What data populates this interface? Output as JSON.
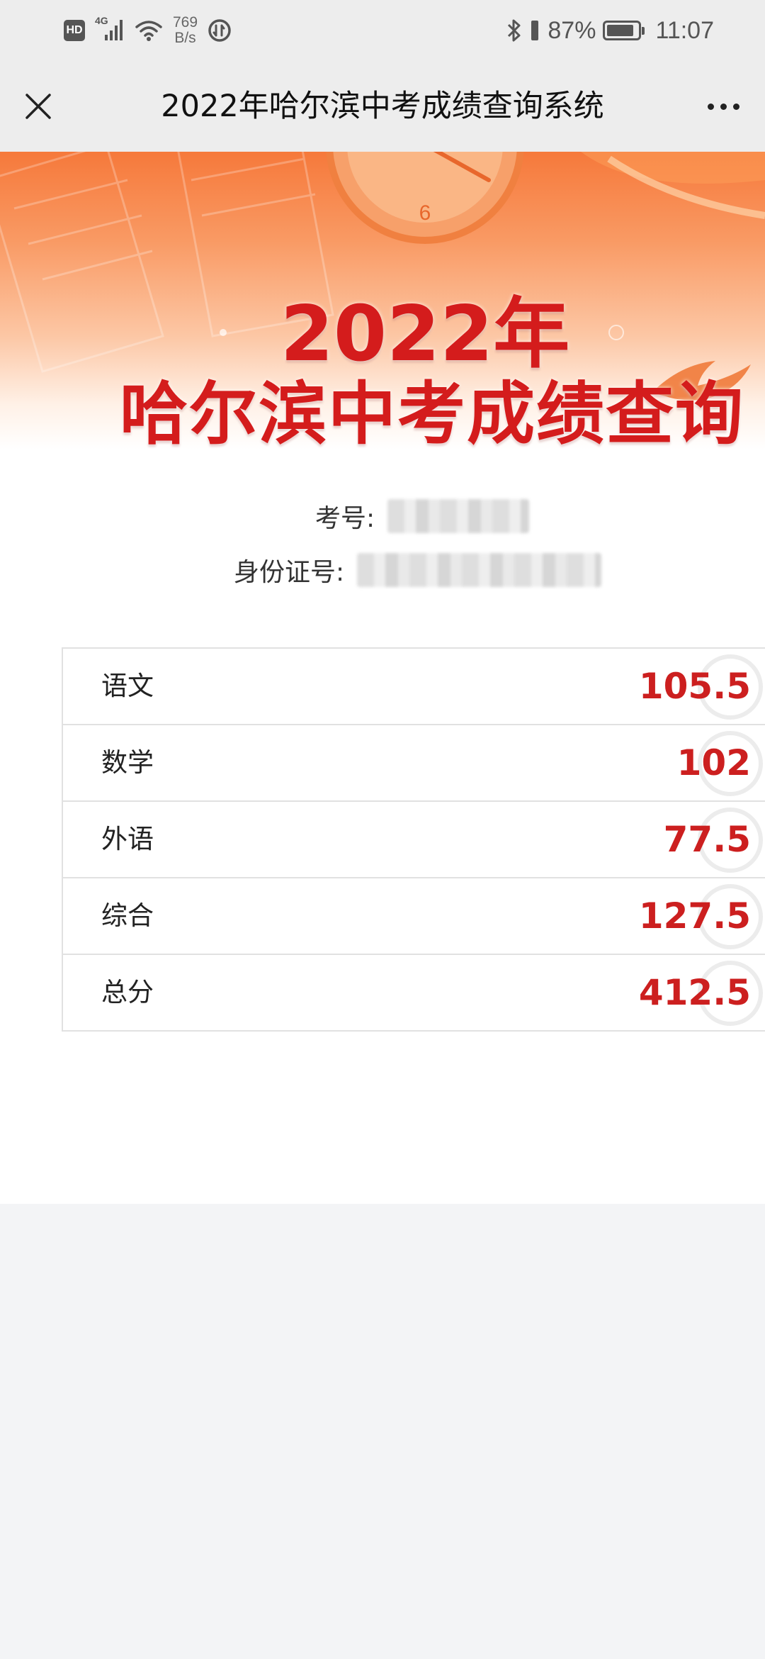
{
  "status_bar": {
    "hd": "HD",
    "network": "4G",
    "speed_value": "769",
    "speed_unit": "B/s",
    "battery_percent": "87%",
    "battery_level": 0.87,
    "time": "11:07"
  },
  "header": {
    "title": "2022年哈尔滨中考成绩查询系统"
  },
  "banner": {
    "year": "2022年",
    "title": "哈尔滨中考成绩查询"
  },
  "info": {
    "exam_no_label": "考号:",
    "id_no_label": "身份证号:"
  },
  "scores": [
    {
      "subject": "语文",
      "score": "105.5"
    },
    {
      "subject": "数学",
      "score": "102"
    },
    {
      "subject": "外语",
      "score": "77.5"
    },
    {
      "subject": "综合",
      "score": "127.5"
    },
    {
      "subject": "总分",
      "score": "412.5"
    }
  ],
  "colors": {
    "accent": "#cc1f1f",
    "banner_orange": "#f6793b",
    "header_bg": "#ededed"
  }
}
